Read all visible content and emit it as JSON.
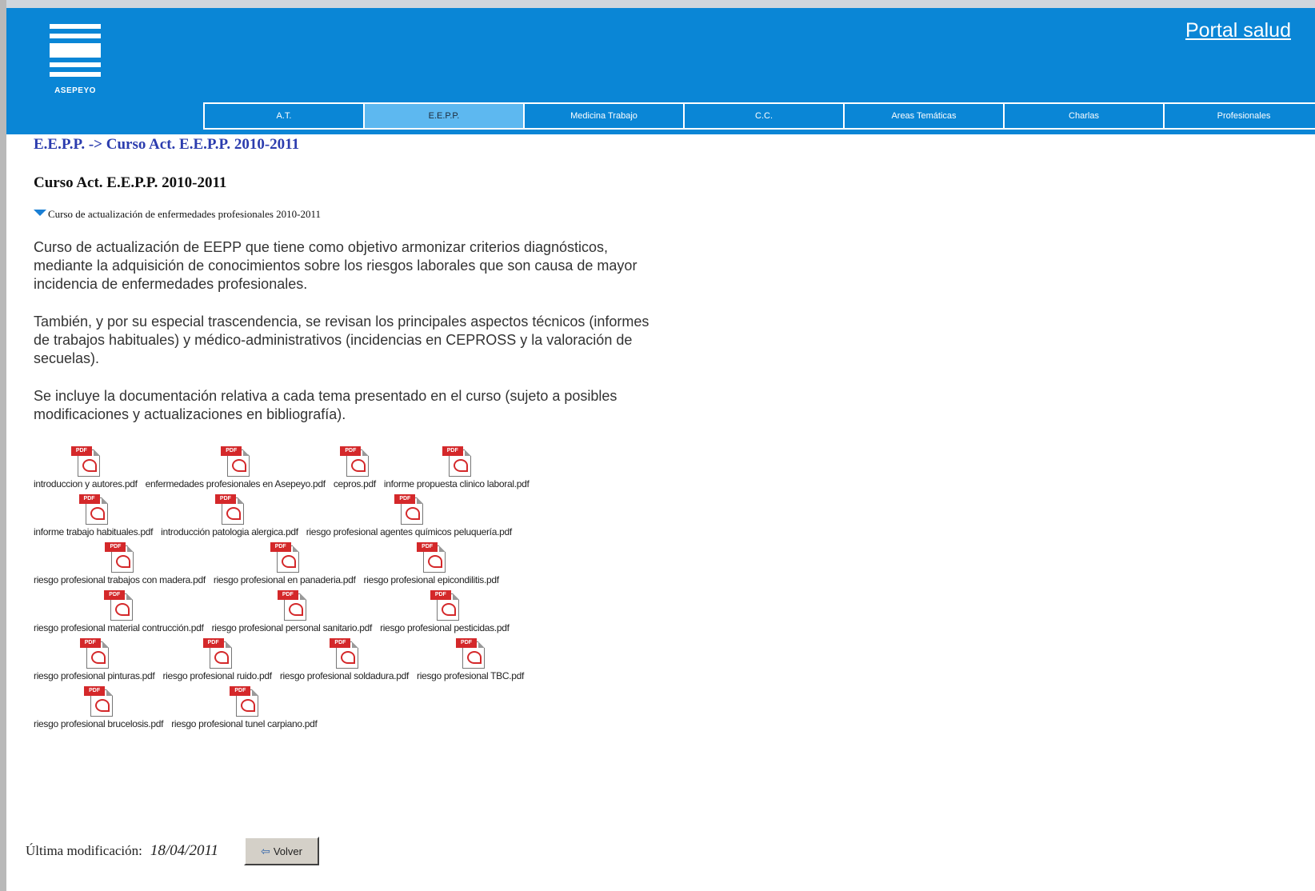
{
  "header": {
    "logo_text": "ASEPEYO",
    "portal_link": "Portal salud",
    "nav": [
      {
        "label": "A.T.",
        "active": false
      },
      {
        "label": "E.E.P.P.",
        "active": true
      },
      {
        "label": "Medicina Trabajo",
        "active": false
      },
      {
        "label": "C.C.",
        "active": false
      },
      {
        "label": "Areas Temáticas",
        "active": false
      },
      {
        "label": "Charlas",
        "active": false
      },
      {
        "label": "Profesionales",
        "active": false
      }
    ]
  },
  "breadcrumb": {
    "parent": "E.E.P.P.",
    "separator": " -> ",
    "current": "Curso Act. E.E.P.P. 2010-2011"
  },
  "page_title": "Curso Act. E.E.P.P. 2010-2011",
  "section_title": "Curso de actualización de enfermedades profesionales 2010-2011",
  "paragraphs": [
    "Curso de actualización de EEPP que tiene como objetivo armonizar criterios diagnósticos, mediante la adquisición de conocimientos sobre los riesgos laborales que son causa de mayor incidencia de enfermedades profesionales.",
    "También, y por su especial trascendencia, se revisan los principales aspectos técnicos (informes de trabajos habituales) y médico-administrativos (incidencias en CEPROSS y la valoración de secuelas).",
    "Se incluye la documentación relativa a cada tema presentado en el curso (sujeto a posibles modificaciones y actualizaciones en bibliografía)."
  ],
  "file_rows": [
    [
      "introduccion y autores.pdf",
      "enfermedades profesionales en Asepeyo.pdf",
      "cepros.pdf",
      "informe propuesta clinico laboral.pdf"
    ],
    [
      "informe trabajo habituales.pdf",
      "introducción patologia alergica.pdf",
      "riesgo profesional agentes químicos peluquería.pdf"
    ],
    [
      "riesgo profesional trabajos con madera.pdf",
      "riesgo profesional en panaderia.pdf",
      "riesgo profesional epicondilitis.pdf"
    ],
    [
      "riesgo profesional material contrucción.pdf",
      "riesgo profesional personal sanitario.pdf",
      "riesgo profesional pesticidas.pdf"
    ],
    [
      "riesgo profesional pinturas.pdf",
      "riesgo profesional ruido.pdf",
      "riesgo profesional soldadura.pdf",
      "riesgo profesional TBC.pdf"
    ],
    [
      "riesgo profesional brucelosis.pdf",
      "riesgo profesional tunel carpiano.pdf"
    ]
  ],
  "pdf_icon_tag": "PDF",
  "footer": {
    "label": "Última modificación:",
    "date": "18/04/2011",
    "back_button": "Volver"
  },
  "colors": {
    "header_bg": "#0a86d6",
    "nav_active_bg": "#5db8f0",
    "breadcrumb": "#2b3cae",
    "pdf_red": "#d4282a"
  }
}
